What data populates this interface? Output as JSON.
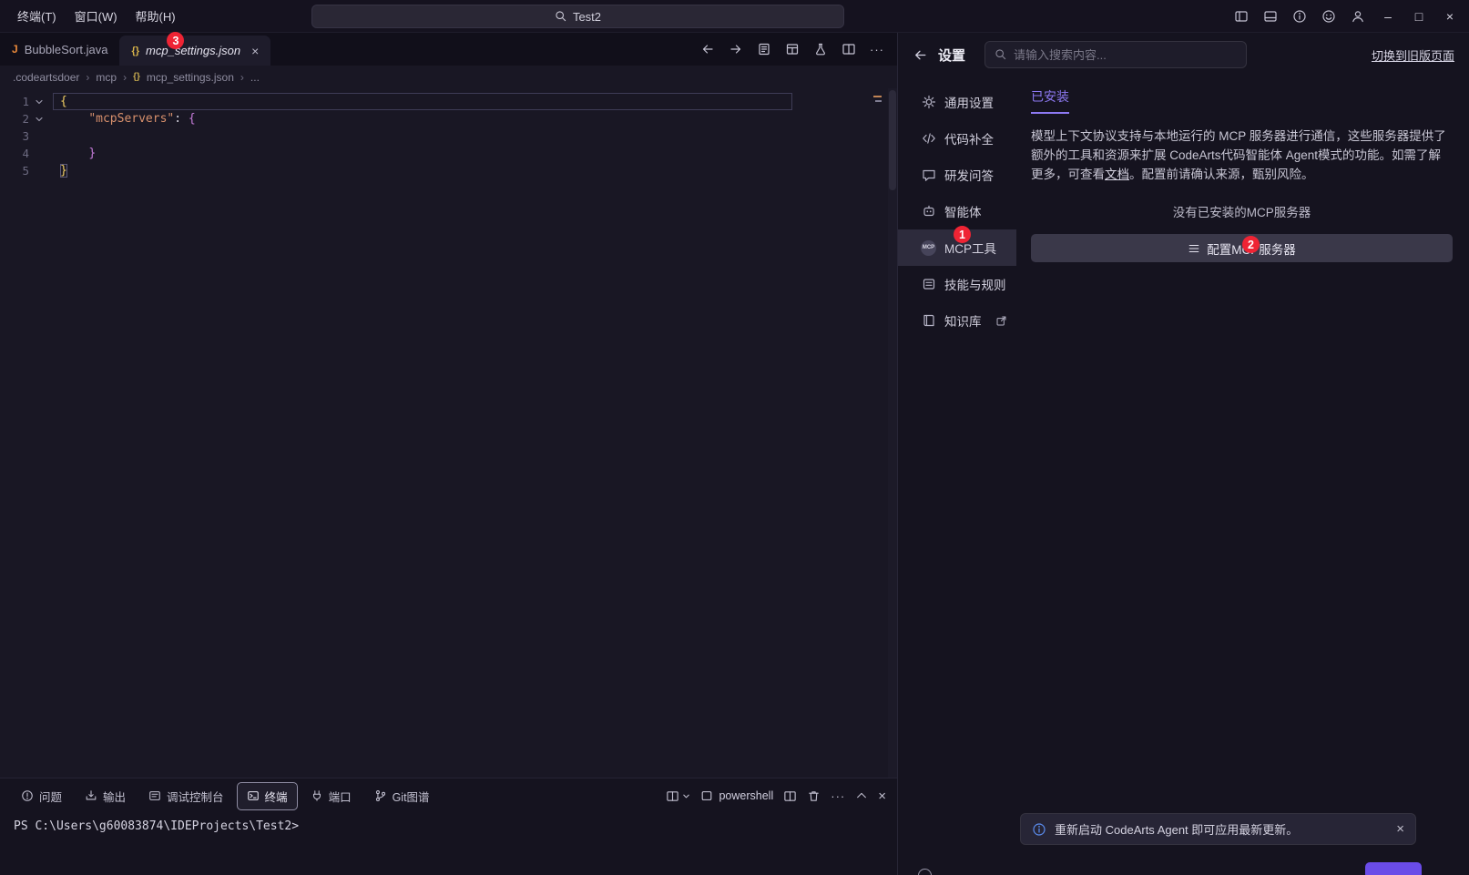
{
  "colors": {
    "accent": "#8d79f2",
    "badge_red": "#ef2434",
    "button_purple": "#6a4ce8"
  },
  "titlebar": {
    "menus": [
      {
        "label": "终端(T)"
      },
      {
        "label": "窗口(W)"
      },
      {
        "label": "帮助(H)"
      }
    ],
    "search_value": "Test2",
    "window": {
      "minimize": "–",
      "maximize": "□",
      "close": "×"
    }
  },
  "editor": {
    "tabs": [
      {
        "label": "BubbleSort.java",
        "icon": "J"
      },
      {
        "label": "mcp_settings.json",
        "icon": "{}",
        "close": "×"
      }
    ],
    "breadcrumb": {
      "root": ".codeartsdoer",
      "folder": "mcp",
      "file_icon": "{}",
      "file": "mcp_settings.json",
      "more": "...",
      "sep": "›"
    },
    "gutter": [
      "1",
      "2",
      "3",
      "4",
      "5"
    ],
    "code": {
      "indent": "    ",
      "l1_brace": "{",
      "l2_key": "\"mcpServers\"",
      "l2_colon": ": ",
      "l2_brace": "{",
      "l4_brace": "}",
      "l5_brace": "}"
    }
  },
  "panel": {
    "tabs": [
      {
        "label": "问题"
      },
      {
        "label": "输出"
      },
      {
        "label": "调试控制台"
      },
      {
        "label": "终端"
      },
      {
        "label": "端口"
      },
      {
        "label": "Git图谱"
      }
    ],
    "shell_name": "powershell",
    "more_glyph": "···",
    "close_glyph": "×",
    "prompt": "PS C:\\Users\\g60083874\\IDEProjects\\Test2>"
  },
  "settings": {
    "title": "设置",
    "search_placeholder": "请输入搜索内容...",
    "legacy_link": "切换到旧版页面",
    "nav": [
      {
        "label": "通用设置"
      },
      {
        "label": "代码补全"
      },
      {
        "label": "研发问答"
      },
      {
        "label": "智能体"
      },
      {
        "label": "MCP工具"
      },
      {
        "label": "技能与规则"
      },
      {
        "label": "知识库"
      }
    ],
    "mcp_logo_text": "MCP",
    "installed_tab": "已安装",
    "desc_before": "模型上下文协议支持与本地运行的 MCP 服务器进行通信，这些服务器提供了额外的工具和资源来扩展 CodeArts代码智能体 Agent模式的功能。如需了解更多，可查看",
    "desc_link": "文档",
    "desc_after": "。配置前请确认来源，甄别风险。",
    "empty_text": "没有已安装的MCP服务器",
    "configure_button": "配置MCP服务器",
    "notification": "重新启动 CodeArts Agent 即可应用最新更新。",
    "notification_close": "×"
  },
  "annotations": {
    "tab_badge": "3",
    "nav_badge": "1",
    "button_badge": "2"
  }
}
